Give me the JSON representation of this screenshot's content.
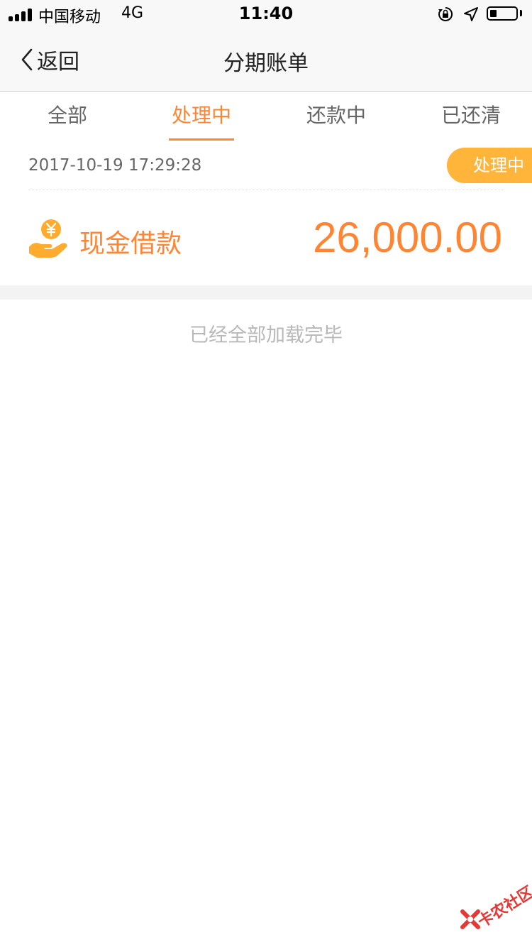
{
  "status_bar": {
    "carrier": "中国移动",
    "network": "4G",
    "time": "11:40",
    "battery_level": 0.25
  },
  "nav": {
    "back_label": "返回",
    "title": "分期账单"
  },
  "tabs": [
    {
      "label": "全部",
      "active": false
    },
    {
      "label": "处理中",
      "active": true
    },
    {
      "label": "还款中",
      "active": false
    },
    {
      "label": "已还清",
      "active": false
    }
  ],
  "bill": {
    "datetime": "2017-10-19 17:29:28",
    "status": "处理中",
    "type": "现金借款",
    "amount": "26,000.00",
    "icon": "cash-hand-icon"
  },
  "list_end_text": "已经全部加载完毕",
  "watermark": {
    "text": "卡农社区"
  },
  "colors": {
    "accent": "#ff8533",
    "status_pill": "#ffb43a",
    "icon": "#ffab2e",
    "watermark": "#e53935"
  }
}
